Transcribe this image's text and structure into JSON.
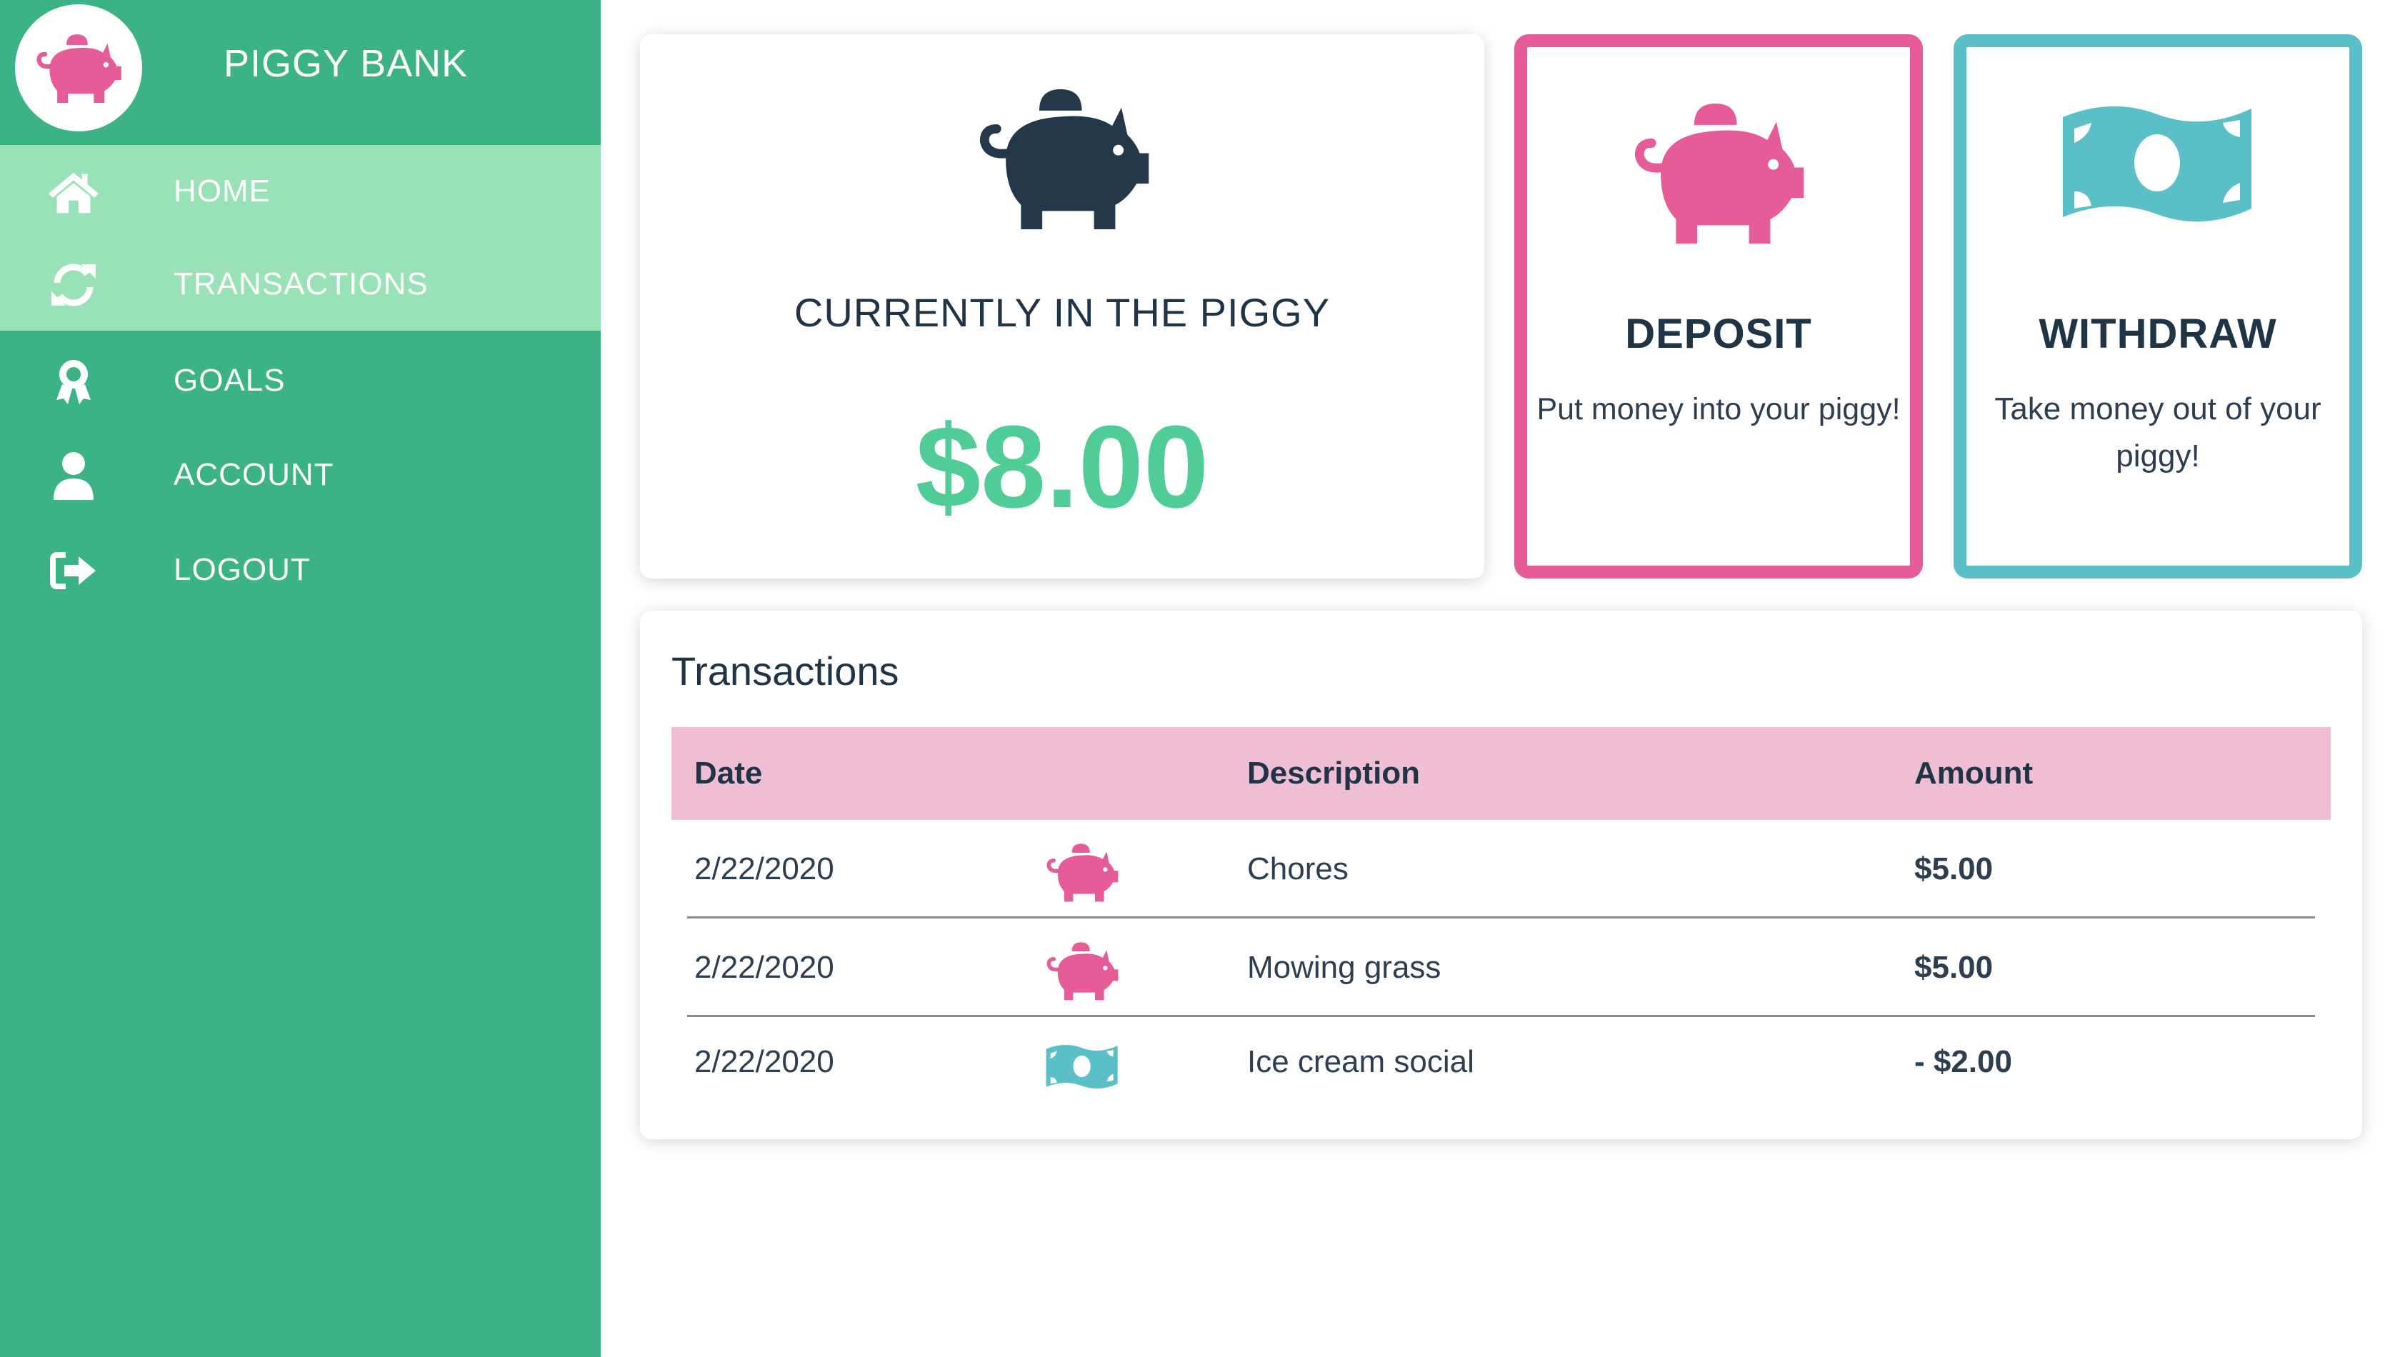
{
  "app": {
    "title": "PIGGY BANK"
  },
  "colors": {
    "sidebar": "#3cb386",
    "active_nav": "#99e1b7",
    "pink": "#e65c98",
    "teal": "#5bbfc8",
    "navy": "#25384a",
    "green": "#4fcc97",
    "red": "#e0263a"
  },
  "nav": [
    {
      "label": "HOME",
      "icon": "home-icon",
      "active": true
    },
    {
      "label": "TRANSACTIONS",
      "icon": "refresh-icon",
      "active": true
    },
    {
      "label": "GOALS",
      "icon": "award-icon",
      "active": false
    },
    {
      "label": "ACCOUNT",
      "icon": "user-icon",
      "active": false
    },
    {
      "label": "LOGOUT",
      "icon": "logout-icon",
      "active": false
    }
  ],
  "balance": {
    "title": "CURRENTLY IN THE PIGGY",
    "amount": "$8.00",
    "icon": "piggy-bank-icon"
  },
  "deposit": {
    "title": "DEPOSIT",
    "description": "Put money into your piggy!",
    "icon": "piggy-bank-icon"
  },
  "withdraw": {
    "title": "WITHDRAW",
    "description": "Take money out of your piggy!",
    "icon": "money-bill-icon"
  },
  "transactions": {
    "title": "Transactions",
    "headers": {
      "date": "Date",
      "description": "Description",
      "amount": "Amount"
    },
    "rows": [
      {
        "date": "2/22/2020",
        "icon": "piggy-bank-icon",
        "description": "Chores",
        "amount": "$5.00",
        "type": "deposit"
      },
      {
        "date": "2/22/2020",
        "icon": "piggy-bank-icon",
        "description": "Mowing grass",
        "amount": "$5.00",
        "type": "deposit"
      },
      {
        "date": "2/22/2020",
        "icon": "money-bill-icon",
        "description": "Ice cream social",
        "amount": "- $2.00",
        "type": "withdraw"
      }
    ]
  }
}
